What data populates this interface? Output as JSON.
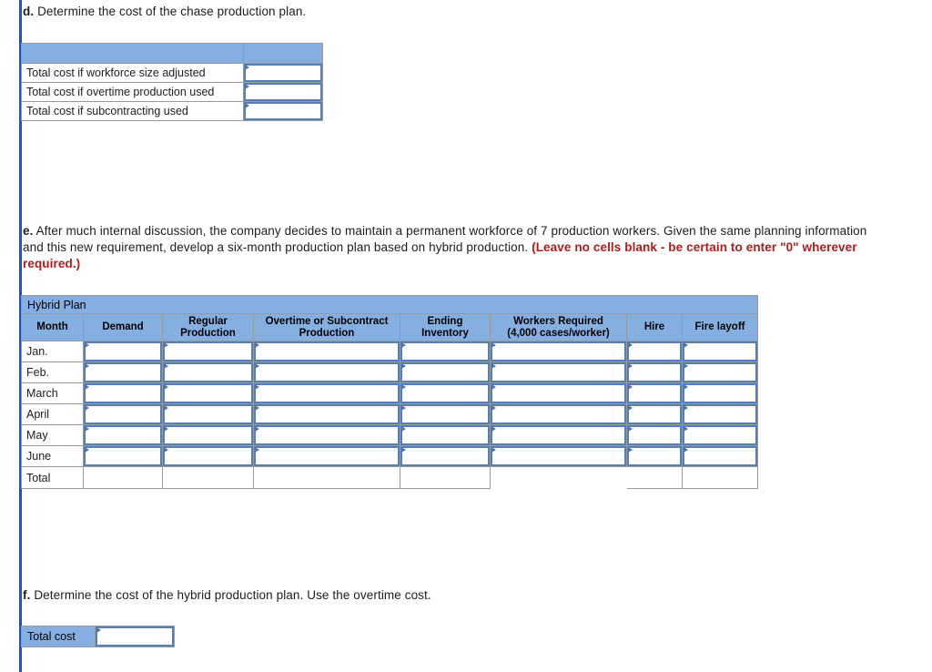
{
  "theme": {
    "accent_bar": "#1a56bc",
    "header_blue": "#85afe0",
    "input_border": "#567fb4",
    "warning_text": "#b01c1c"
  },
  "section_d": {
    "lead": "d.",
    "text": "Determine the cost of the chase production plan.",
    "table": {
      "header_left": "",
      "header_right": "",
      "rows": [
        {
          "label": "Total cost if workforce size adjusted",
          "value": ""
        },
        {
          "label": "Total cost if overtime production used",
          "value": ""
        },
        {
          "label": "Total cost if subcontracting used",
          "value": ""
        }
      ]
    }
  },
  "section_e": {
    "lead": "e.",
    "text": "After much internal discussion, the company decides to maintain a permanent workforce of 7 production workers. Given the same planning information and this new requirement, develop a six-month production plan based on hybrid production.",
    "warning": "(Leave no cells blank - be certain to enter \"0\" wherever required.)",
    "table": {
      "title": "Hybrid Plan",
      "columns": [
        "Month",
        "Demand",
        "Regular Production",
        "Overtime or Subcontract Production",
        "Ending Inventory",
        "Workers Required (4,000 cases/worker)",
        "Hire",
        "Fire layoff"
      ],
      "columns_display": [
        {
          "line1": "Month",
          "line2": ""
        },
        {
          "line1": "Demand",
          "line2": ""
        },
        {
          "line1": "Regular",
          "line2": "Production"
        },
        {
          "line1": "Overtime or Subcontract",
          "line2": "Production"
        },
        {
          "line1": "Ending",
          "line2": "Inventory"
        },
        {
          "line1": "Workers Required",
          "line2": "(4,000 cases/worker)"
        },
        {
          "line1": "Hire",
          "line2": ""
        },
        {
          "line1": "Fire layoff",
          "line2": ""
        }
      ],
      "rows": [
        {
          "month": "Jan.",
          "demand": "",
          "regular": "",
          "overtime": "",
          "ending": "",
          "workers": "",
          "hire": "",
          "fire": ""
        },
        {
          "month": "Feb.",
          "demand": "",
          "regular": "",
          "overtime": "",
          "ending": "",
          "workers": "",
          "hire": "",
          "fire": ""
        },
        {
          "month": "March",
          "demand": "",
          "regular": "",
          "overtime": "",
          "ending": "",
          "workers": "",
          "hire": "",
          "fire": ""
        },
        {
          "month": "April",
          "demand": "",
          "regular": "",
          "overtime": "",
          "ending": "",
          "workers": "",
          "hire": "",
          "fire": ""
        },
        {
          "month": "May",
          "demand": "",
          "regular": "",
          "overtime": "",
          "ending": "",
          "workers": "",
          "hire": "",
          "fire": ""
        },
        {
          "month": "June",
          "demand": "",
          "regular": "",
          "overtime": "",
          "ending": "",
          "workers": "",
          "hire": "",
          "fire": ""
        }
      ],
      "total_row": {
        "month": "Total",
        "demand": "",
        "regular": "",
        "overtime": "",
        "ending": "",
        "workers": "",
        "hire": "",
        "fire": ""
      }
    }
  },
  "section_f": {
    "lead": "f.",
    "text": "Determine the cost of the hybrid production plan. Use the overtime cost.",
    "table": {
      "label": "Total cost",
      "value": ""
    }
  }
}
